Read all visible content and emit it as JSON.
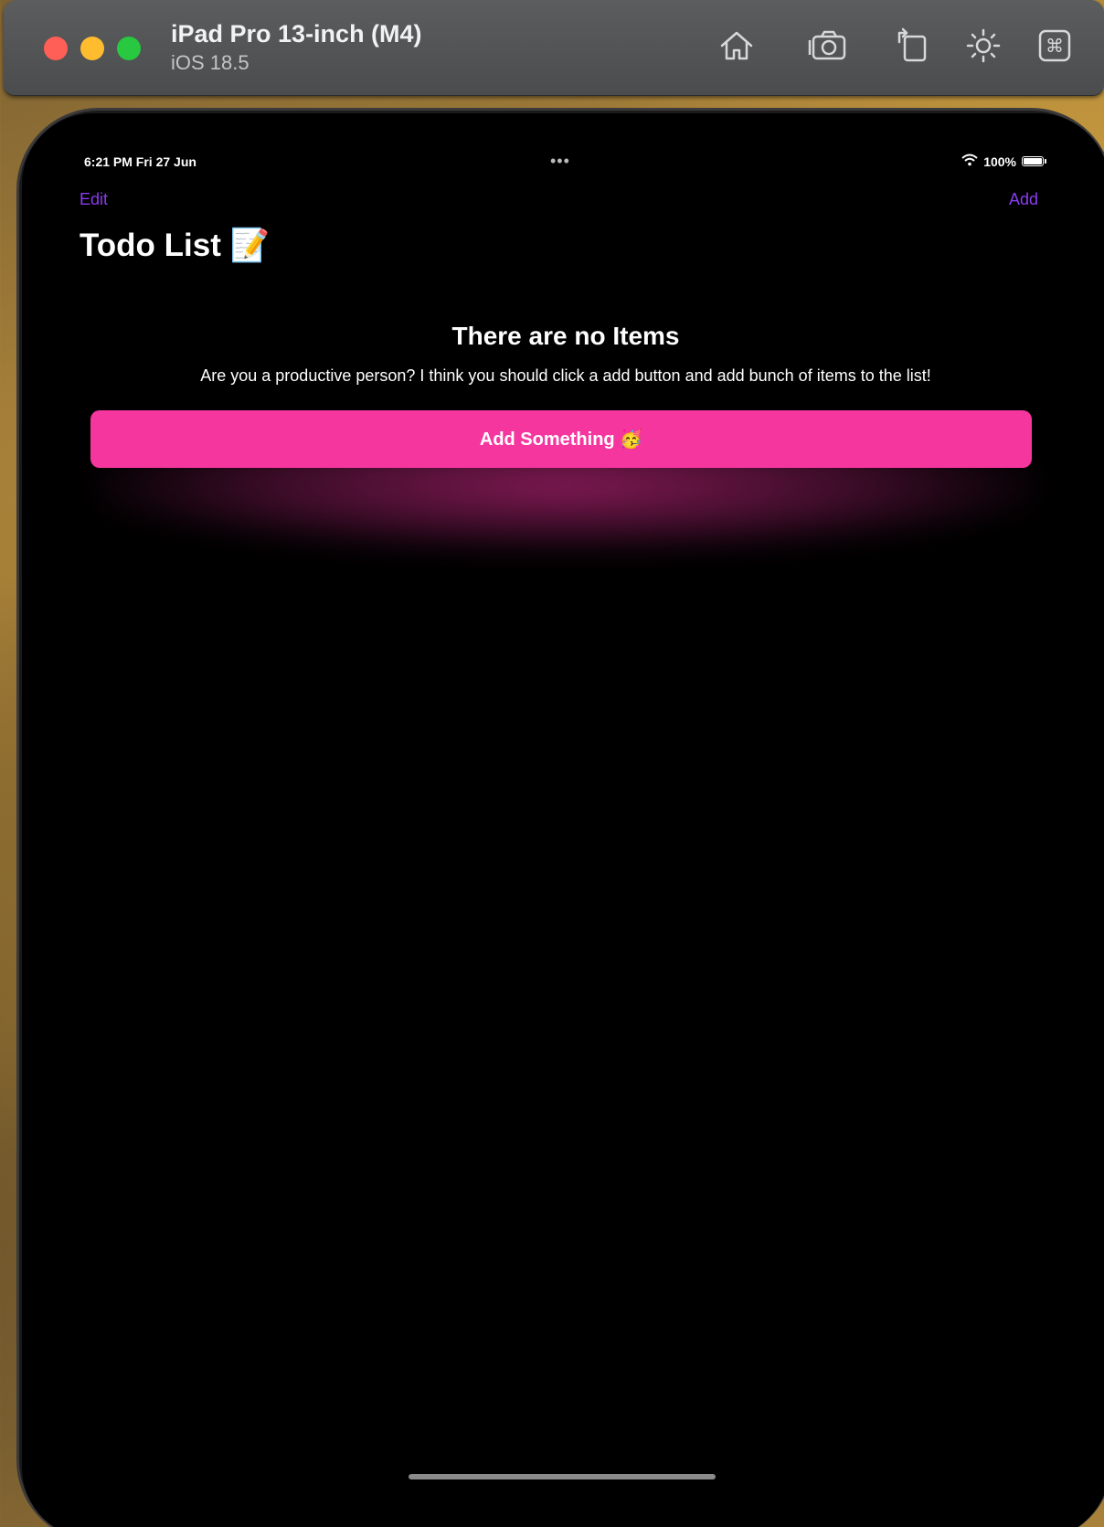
{
  "simulator": {
    "device_name": "iPad Pro 13-inch (M4)",
    "os_version": "iOS 18.5",
    "toolbar_icons": [
      "home-icon",
      "screenshot-camera-icon",
      "rotate-icon",
      "appearance-sun-icon",
      "command-icon"
    ]
  },
  "status_bar": {
    "time_date": "6:21 PM  Fri 27 Jun",
    "multitask_indicator": "•••",
    "battery_percent": "100%"
  },
  "nav_bar": {
    "edit_label": "Edit",
    "add_label": "Add",
    "title": "Todo List 📝"
  },
  "empty_state": {
    "heading": "There are no Items",
    "body": "Are you a productive person? I think you should click a add button and add bunch of items to the list!",
    "button_label": "Add Something 🥳"
  },
  "colors": {
    "accent": "#8b3bf0",
    "button": "#f5369e",
    "background": "#000000"
  }
}
